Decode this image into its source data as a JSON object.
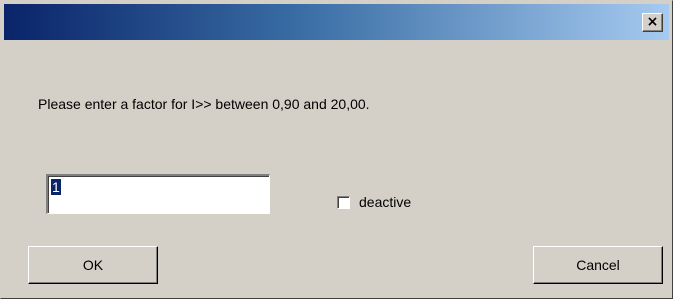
{
  "titlebar": {
    "close_glyph": "×",
    "gradient_start": "#0a246a",
    "gradient_end": "#a6caf0"
  },
  "dialog": {
    "prompt": "Please enter a factor for I>> between 0,90 and 20,00.",
    "factor_value": "1",
    "deactive_label": "deactive",
    "deactive_checked": false,
    "ok_label": "OK",
    "cancel_label": "Cancel"
  }
}
